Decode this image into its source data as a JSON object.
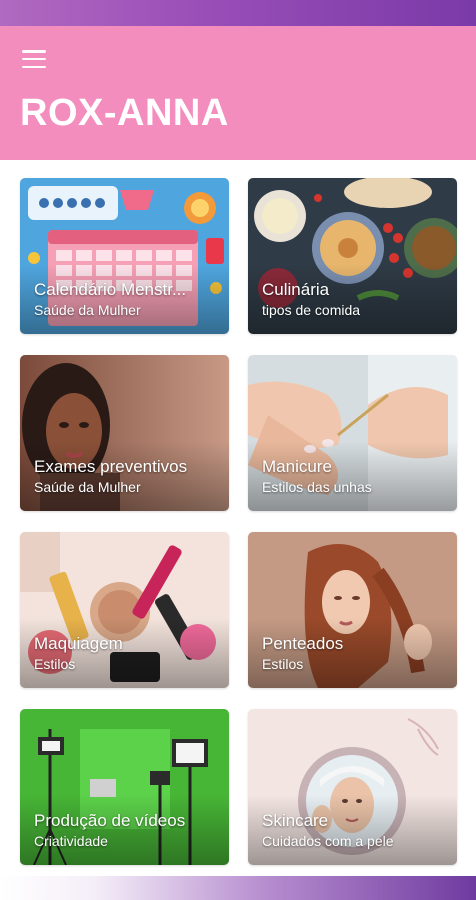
{
  "app": {
    "title": "ROX-ANNA",
    "menu_icon": "hamburger-menu-icon",
    "header_color": "#f38dbe",
    "accent_color": "#8a44b0"
  },
  "cards": [
    {
      "title": "Calendário Menstr...",
      "subtitle": "Saúde da Mulher"
    },
    {
      "title": "Culinária",
      "subtitle": "tipos de comida"
    },
    {
      "title": "Exames preventivos",
      "subtitle": "Saúde da Mulher"
    },
    {
      "title": "Manicure",
      "subtitle": "Estilos das unhas"
    },
    {
      "title": "Maquiagem",
      "subtitle": "Estilos"
    },
    {
      "title": "Penteados",
      "subtitle": "Estilos"
    },
    {
      "title": "Produção de vídeos",
      "subtitle": "Criatividade"
    },
    {
      "title": "Skincare",
      "subtitle": "Cuidados com a pele"
    }
  ]
}
